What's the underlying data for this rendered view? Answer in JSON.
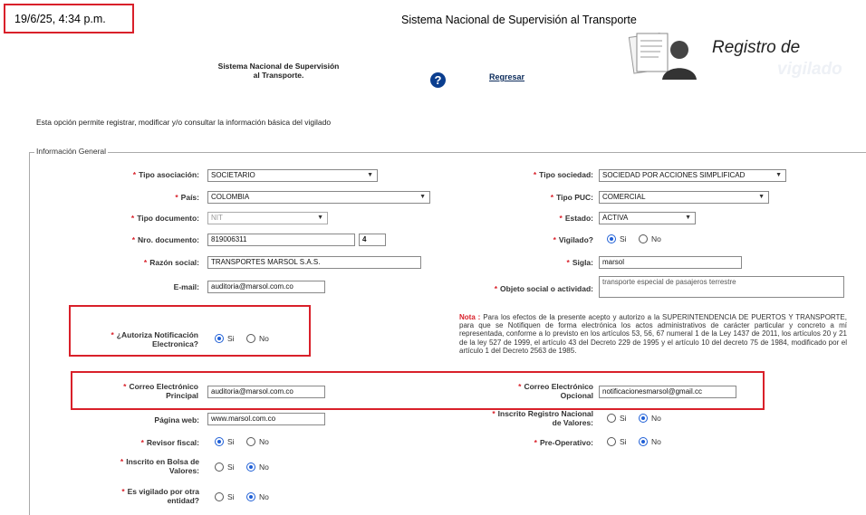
{
  "header": {
    "timestamp": "19/6/25, 4:34 p.m.",
    "doc_title": "Sistema Nacional de Supervisión al Transporte",
    "registro_title": "Registro de",
    "registro_sub": "vigilado",
    "site_name_line1": "Sistema Nacional de Supervisión",
    "site_name_line2": "al Transporte.",
    "help_glyph": "?",
    "back_link": "Regresar"
  },
  "intro": "Esta opción permite registrar, modificar y/o consultar la información básica del vigilado",
  "legend": "Información General",
  "form": {
    "tipo_asociacion": {
      "label": "Tipo asociación:",
      "value": "SOCIETARIO"
    },
    "tipo_sociedad": {
      "label": "Tipo sociedad:",
      "value": "SOCIEDAD POR ACCIONES SIMPLIFICAD"
    },
    "pais": {
      "label": "País:",
      "value": "COLOMBIA"
    },
    "tipo_puc": {
      "label": "Tipo PUC:",
      "value": "COMERCIAL"
    },
    "tipo_documento": {
      "label": "Tipo documento:",
      "value": "NIT"
    },
    "estado": {
      "label": "Estado:",
      "value": "ACTIVA"
    },
    "nro_documento": {
      "label": "Nro. documento:",
      "value": "819006311",
      "dv": "4"
    },
    "vigilado": {
      "label": "Vigilado?",
      "si": "Si",
      "no": "No",
      "selected": "Si"
    },
    "razon_social": {
      "label": "Razón social:",
      "value": "TRANSPORTES  MARSOL S.A.S."
    },
    "sigla": {
      "label": "Sigla:",
      "value": "marsol"
    },
    "email": {
      "label": "E-mail:",
      "value": "auditoria@marsol.com.co"
    },
    "objeto_social": {
      "label": "Objeto social o actividad:",
      "value": "transporte especial de pasajeros terrestre"
    },
    "autoriza_line1": "¿Autoriza Notificación",
    "autoriza_line2": "Electronica?",
    "autoriza": {
      "si": "Si",
      "no": "No",
      "selected": "Si"
    },
    "note_label": "Nota :",
    "note_text": "Para los efectos de la presente acepto y autorizo a la SUPERINTENDENCIA DE PUERTOS Y TRANSPORTE, para que se Notifiquen de forma electrónica los actos administrativos de carácter particular y concreto a mí representada, conforme a lo previsto en los artículos 53, 56, 67 numeral 1 de la Ley 1437 de 2011, los artículos 20 y 21 de la ley 527 de 1999, el artículo 43 del Decreto 229 de 1995 y el artículo 10 del decreto 75 de 1984, modificado por el artículo 1 del Decreto 2563 de 1985.",
    "correo_principal_line1": "Correo Electrónico",
    "correo_principal_line2": "Principal",
    "correo_principal": "auditoria@marsol.com.co",
    "correo_opcional_line1": "Correo Electrónico",
    "correo_opcional_line2": "Opcional",
    "correo_opcional": "notificacionesmarsol@gmail.cc",
    "pagina_web": {
      "label": "Página web:",
      "value": "www.marsol.com.co"
    },
    "inscrito_rnv_line1": "Inscrito Registro Nacional",
    "inscrito_rnv_line2": "de Valores:",
    "inscrito_rnv": {
      "si": "Si",
      "no": "No",
      "selected": "No"
    },
    "revisor_fiscal": {
      "label": "Revisor fiscal:",
      "si": "Si",
      "no": "No",
      "selected": "Si"
    },
    "pre_operativo": {
      "label": "Pre-Operativo:",
      "si": "Si",
      "no": "No",
      "selected": "No"
    },
    "inscrito_bolsa_line1": "Inscrito en Bolsa de",
    "inscrito_bolsa_line2": "Valores:",
    "inscrito_bolsa": {
      "si": "Si",
      "no": "No",
      "selected": "No"
    },
    "es_vigilado_line1": "Es vigilado por otra",
    "es_vigilado_line2": "entidad?",
    "es_vigilado": {
      "si": "Si",
      "no": "No",
      "selected": "No"
    }
  },
  "colors": {
    "required": "#d9202a",
    "highlight": "#d9202a",
    "radio": "#1f5fd6",
    "help": "#0b3e8f"
  },
  "icons": {
    "help": "help-circle-icon",
    "chevron": "chevron-down-icon",
    "registro": "user-document-icon"
  }
}
